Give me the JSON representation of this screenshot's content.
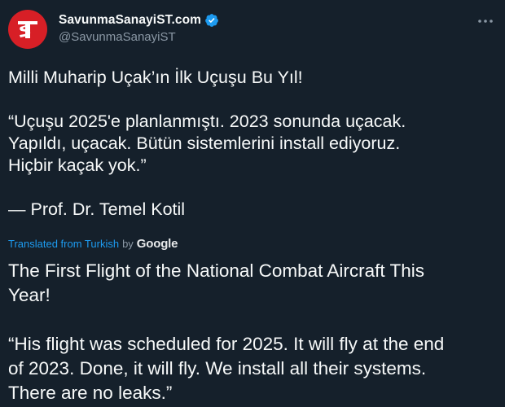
{
  "account": {
    "display_name": "SavunmaSanayiST.com",
    "handle": "@SavunmaSanayiST",
    "avatar_text": "ST",
    "verified": true,
    "brand_color": "#d71f26"
  },
  "tweet": {
    "original": {
      "line1": "Milli Muharip Uçak’ın İlk Uçuşu Bu Yıl!",
      "quote_line1": "“Uçuşu 2025'e planlanmıştı. 2023 sonunda uçacak.",
      "quote_line2": "Yapıldı, uçacak. Bütün sistemlerini install ediyoruz.",
      "quote_line3": "Hiçbir kaçak yok.”",
      "attribution": "— Prof. Dr. Temel Kotil"
    },
    "translation_notice": {
      "text": "Translated from Turkish",
      "by": "by",
      "provider": "Google"
    },
    "translation": {
      "line1": "The First Flight of the National Combat Aircraft This",
      "line2": "Year!",
      "quote_line1": "“His flight was scheduled for 2025. It will fly at the end",
      "quote_line2": "of 2023. Done, it will fly. We install all their systems.",
      "quote_line3": "There are no leaks.”"
    }
  },
  "icons": {
    "verified": "verified-badge-icon",
    "more": "more-options-icon"
  },
  "colors": {
    "background": "#15202b",
    "text": "#f7f9f9",
    "secondary": "#8b98a5",
    "link": "#1d9bf0"
  }
}
